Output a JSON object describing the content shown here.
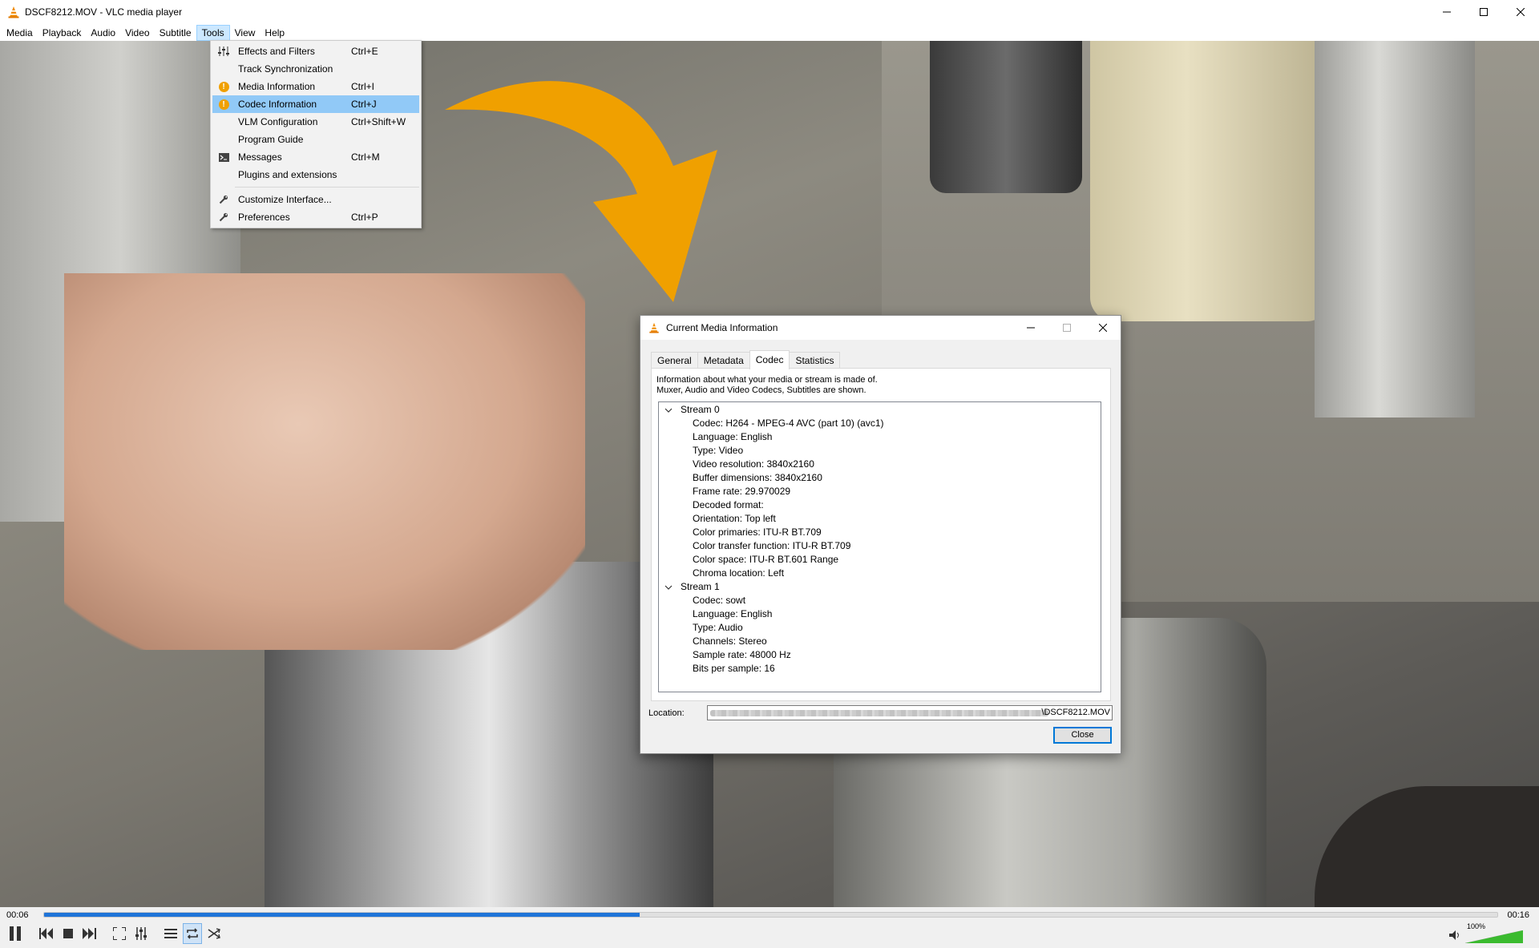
{
  "window": {
    "title": "DSCF8212.MOV - VLC media player"
  },
  "menubar": {
    "items": [
      "Media",
      "Playback",
      "Audio",
      "Video",
      "Subtitle",
      "Tools",
      "View",
      "Help"
    ],
    "active": "Tools"
  },
  "tools_menu": {
    "items": [
      {
        "label": "Effects and Filters",
        "shortcut": "Ctrl+E",
        "icon": "equalizer-icon"
      },
      {
        "label": "Track Synchronization",
        "shortcut": "",
        "icon": ""
      },
      {
        "label": "Media Information",
        "shortcut": "Ctrl+I",
        "icon": "info-icon"
      },
      {
        "label": "Codec Information",
        "shortcut": "Ctrl+J",
        "icon": "info-icon",
        "highlighted": true
      },
      {
        "label": "VLM Configuration",
        "shortcut": "Ctrl+Shift+W",
        "icon": ""
      },
      {
        "label": "Program Guide",
        "shortcut": "",
        "icon": ""
      },
      {
        "label": "Messages",
        "shortcut": "Ctrl+M",
        "icon": "terminal-icon"
      },
      {
        "label": "Plugins and extensions",
        "shortcut": "",
        "icon": ""
      },
      {
        "label": "Customize Interface...",
        "shortcut": "",
        "icon": "wrench-icon"
      },
      {
        "label": "Preferences",
        "shortcut": "Ctrl+P",
        "icon": "wrench-icon"
      }
    ]
  },
  "dialog": {
    "title": "Current Media Information",
    "tabs": [
      "General",
      "Metadata",
      "Codec",
      "Statistics"
    ],
    "active_tab": "Codec",
    "description_line1": "Information about what your media or stream is made of.",
    "description_line2": "Muxer, Audio and Video Codecs, Subtitles are shown.",
    "streams": [
      {
        "name": "Stream 0",
        "props": [
          "Codec: H264 - MPEG-4 AVC (part 10) (avc1)",
          "Language: English",
          "Type: Video",
          "Video resolution: 3840x2160",
          "Buffer dimensions: 3840x2160",
          "Frame rate: 29.970029",
          "Decoded format:",
          "Orientation: Top left",
          "Color primaries: ITU-R BT.709",
          "Color transfer function: ITU-R BT.709",
          "Color space: ITU-R BT.601 Range",
          "Chroma location: Left"
        ]
      },
      {
        "name": "Stream 1",
        "props": [
          "Codec: sowt",
          "Language: English",
          "Type: Audio",
          "Channels: Stereo",
          "Sample rate: 48000 Hz",
          "Bits per sample: 16"
        ]
      }
    ],
    "location_label": "Location:",
    "location_visible_text": "\\DSCF8212.MOV",
    "close_label": "Close"
  },
  "playback": {
    "elapsed": "00:06",
    "duration": "00:16",
    "progress_percent": 41,
    "volume_label": "100%",
    "volume_percent": 100
  },
  "colors": {
    "accent_blue": "#1f74d8",
    "menu_highlight": "#91c9f7",
    "arrow_orange": "#f0a000",
    "info_orange": "#f0a000"
  }
}
